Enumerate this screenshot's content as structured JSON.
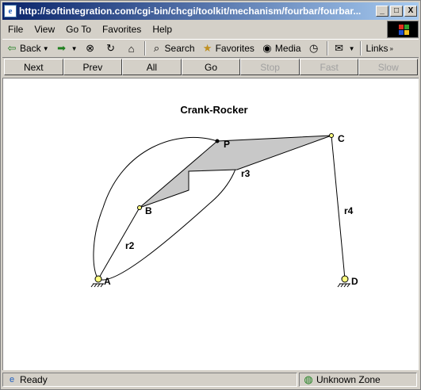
{
  "window": {
    "title": "http://softintegration.com/cgi-bin/chcgi/toolkit/mechanism/fourbar/fourbar...",
    "minimize": "_",
    "maximize": "□",
    "close": "X"
  },
  "menu": [
    "File",
    "View",
    "Go To",
    "Favorites",
    "Help"
  ],
  "toolbar": {
    "back": "Back",
    "search": "Search",
    "favorites": "Favorites",
    "media": "Media",
    "links": "Links"
  },
  "nav_buttons": [
    {
      "label": "Next",
      "enabled": true
    },
    {
      "label": "Prev",
      "enabled": true
    },
    {
      "label": "All",
      "enabled": true
    },
    {
      "label": "Go",
      "enabled": true
    },
    {
      "label": "Stop",
      "enabled": false
    },
    {
      "label": "Fast",
      "enabled": false
    },
    {
      "label": "Slow",
      "enabled": false
    }
  ],
  "figure": {
    "title": "Crank-Rocker",
    "labels": {
      "P": "P",
      "C": "C",
      "B": "B",
      "A": "A",
      "D": "D",
      "r2": "r2",
      "r3": "r3",
      "r4": "r4"
    },
    "coupler_fill": "#c8c8c8",
    "joint_fill": "#ffff80"
  },
  "status": {
    "text": "Ready",
    "zone": "Unknown Zone"
  },
  "colors": {
    "title_start": "#0a246a",
    "title_end": "#a6caf0",
    "chrome": "#d4d0c8"
  }
}
